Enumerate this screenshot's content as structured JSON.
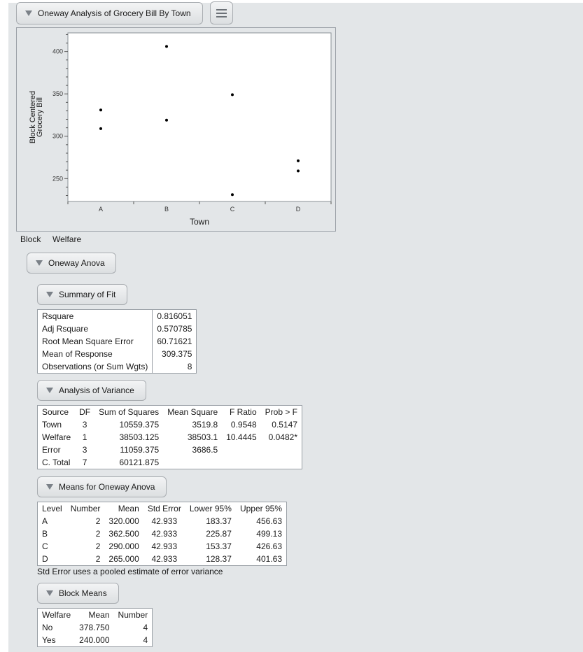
{
  "report": {
    "title": "Oneway Analysis of Grocery Bill By Town",
    "block_label": "Block",
    "block_value": "Welfare"
  },
  "chart_data": {
    "type": "scatter",
    "xlabel": "Town",
    "ylabel": "Block Centered Grocery Bill",
    "ylabel_lines": [
      "Block Centered",
      "Grocery Bill"
    ],
    "categories": [
      "A",
      "B",
      "C",
      "D"
    ],
    "y_ticks": [
      250,
      300,
      350,
      400
    ],
    "ylim": [
      223,
      422
    ],
    "points": [
      {
        "x": "A",
        "y": 331
      },
      {
        "x": "A",
        "y": 309
      },
      {
        "x": "B",
        "y": 406
      },
      {
        "x": "B",
        "y": 319
      },
      {
        "x": "C",
        "y": 349
      },
      {
        "x": "C",
        "y": 231
      },
      {
        "x": "D",
        "y": 271
      },
      {
        "x": "D",
        "y": 259
      }
    ],
    "grid": false,
    "point_color": "#000000"
  },
  "oneway_anova": {
    "title": "Oneway Anova",
    "summary_of_fit": {
      "title": "Summary of Fit",
      "rows": [
        {
          "label": "Rsquare",
          "value": "0.816051"
        },
        {
          "label": "Adj Rsquare",
          "value": "0.570785"
        },
        {
          "label": "Root Mean Square Error",
          "value": "60.71621"
        },
        {
          "label": "Mean of Response",
          "value": "309.375"
        },
        {
          "label": "Observations (or Sum Wgts)",
          "value": "8"
        }
      ]
    },
    "analysis_of_variance": {
      "title": "Analysis of Variance",
      "headers": [
        "Source",
        "DF",
        "Sum of Squares",
        "Mean Square",
        "F Ratio",
        "Prob > F"
      ],
      "rows": [
        {
          "source": "Town",
          "df": "3",
          "ss": "10559.375",
          "ms": "3519.8",
          "f": "0.9548",
          "p": "0.5147"
        },
        {
          "source": "Welfare",
          "df": "1",
          "ss": "38503.125",
          "ms": "38503.1",
          "f": "10.4445",
          "p": "0.0482*"
        },
        {
          "source": "Error",
          "df": "3",
          "ss": "11059.375",
          "ms": "3686.5",
          "f": "",
          "p": ""
        },
        {
          "source": "C. Total",
          "df": "7",
          "ss": "60121.875",
          "ms": "",
          "f": "",
          "p": ""
        }
      ],
      "significant_color": "#000000"
    },
    "means": {
      "title": "Means for Oneway Anova",
      "headers": [
        "Level",
        "Number",
        "Mean",
        "Std Error",
        "Lower 95%",
        "Upper 95%"
      ],
      "rows": [
        {
          "level": "A",
          "n": "2",
          "mean": "320.000",
          "se": "42.933",
          "lo": "183.37",
          "hi": "456.63"
        },
        {
          "level": "B",
          "n": "2",
          "mean": "362.500",
          "se": "42.933",
          "lo": "225.87",
          "hi": "499.13"
        },
        {
          "level": "C",
          "n": "2",
          "mean": "290.000",
          "se": "42.933",
          "lo": "153.37",
          "hi": "426.63"
        },
        {
          "level": "D",
          "n": "2",
          "mean": "265.000",
          "se": "42.933",
          "lo": "128.37",
          "hi": "401.63"
        }
      ],
      "note": "Std Error uses a pooled estimate of error variance"
    },
    "block_means": {
      "title": "Block Means",
      "headers": [
        "Welfare",
        "Mean",
        "Number"
      ],
      "rows": [
        {
          "welfare": "No",
          "mean": "378.750",
          "n": "4"
        },
        {
          "welfare": "Yes",
          "mean": "240.000",
          "n": "4"
        }
      ]
    }
  }
}
